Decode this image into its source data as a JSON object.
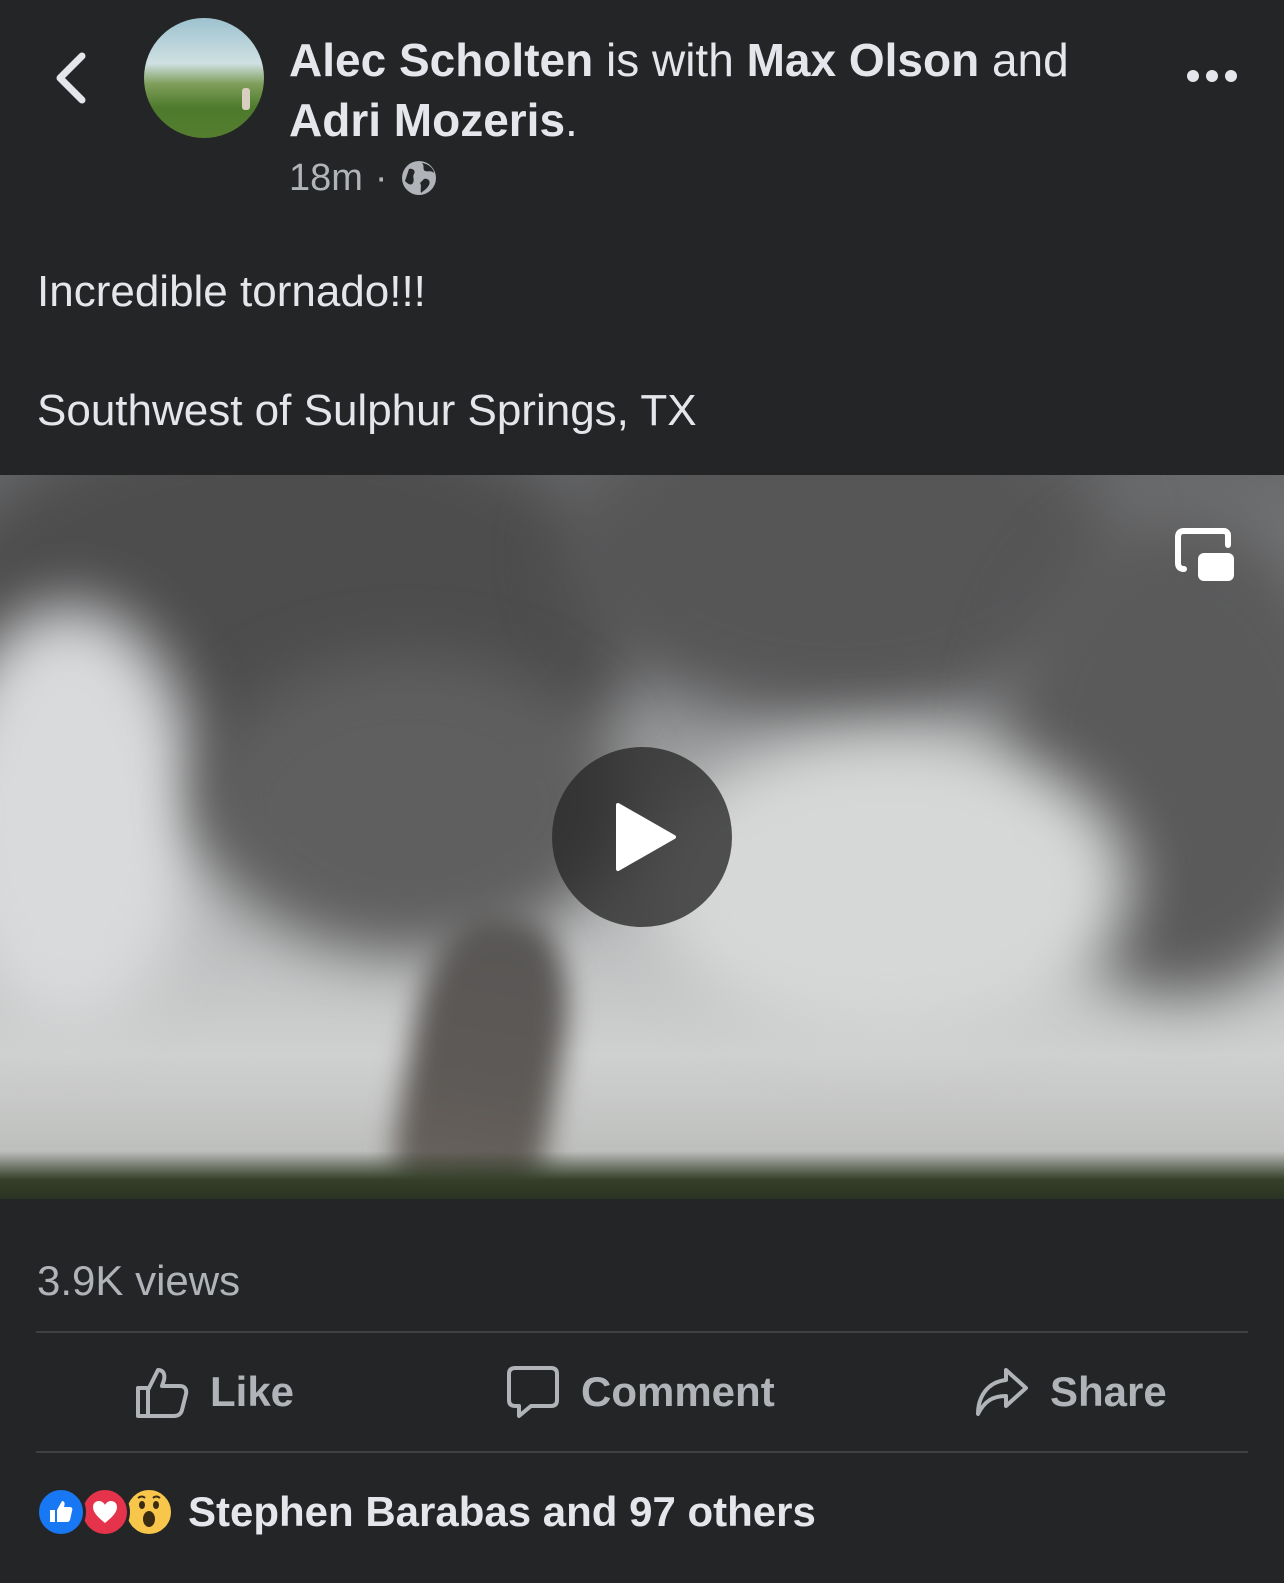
{
  "post": {
    "author": "Alec Scholten",
    "with_text": "is with",
    "tagged_1": "Max Olson",
    "and_text": "and",
    "tagged_2": "Adri Mozeris",
    "period": ".",
    "time": "18m",
    "separator": "·",
    "privacy_icon": "globe-icon",
    "text_line_1": "Incredible tornado!!!",
    "text_line_2": "Southwest of Sulphur Springs, TX"
  },
  "video": {
    "play_icon": "play-icon",
    "pip_icon": "picture-in-picture-icon"
  },
  "stats": {
    "views": "3.9K views"
  },
  "actions": {
    "like": "Like",
    "comment": "Comment",
    "share": "Share"
  },
  "reactions": {
    "icons": [
      "like-reaction-icon",
      "love-reaction-icon",
      "wow-reaction-icon"
    ],
    "summary": "Stephen Barabas and 97 others"
  },
  "colors": {
    "background": "#242527",
    "text_primary": "#e4e6eb",
    "text_secondary": "#b0b3b8",
    "like_blue": "#1877f2",
    "love_red": "#e4334a",
    "wow_yellow": "#f7c64a"
  }
}
